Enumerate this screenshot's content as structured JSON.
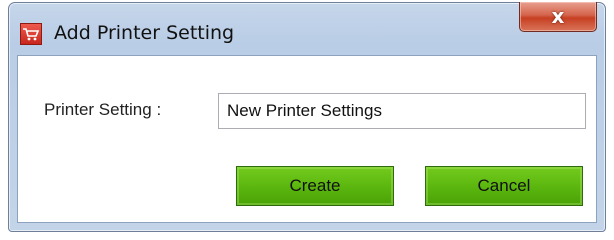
{
  "window": {
    "title": "Add Printer Setting",
    "close_label": "x",
    "icon": "cart-icon"
  },
  "form": {
    "printer_setting_label": "Printer Setting :",
    "printer_setting_value": "New Printer Settings"
  },
  "buttons": {
    "create_label": "Create",
    "cancel_label": "Cancel"
  },
  "colors": {
    "button_green": "#5cb70f",
    "close_red": "#c73f22",
    "titlebar_blue": "#b9cde6"
  }
}
